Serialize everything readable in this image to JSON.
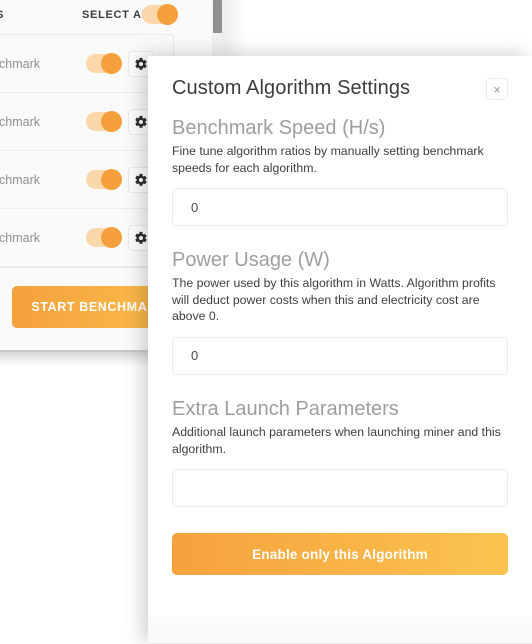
{
  "background_panel": {
    "list_header": {
      "truncated_label": "S",
      "select_all_label": "SELECT ALL",
      "select_all_toggle": {
        "name": "select-all-toggle",
        "state": "on"
      }
    },
    "algorithm_rows": [
      {
        "name_truncated": "chmark",
        "toggle_state": "on",
        "settings_icon": "gear-icon"
      },
      {
        "name_truncated": "chmark",
        "toggle_state": "on",
        "settings_icon": "gear-icon"
      },
      {
        "name_truncated": "chmark",
        "toggle_state": "on",
        "settings_icon": "gear-icon"
      },
      {
        "name_truncated": "chmark",
        "toggle_state": "on",
        "settings_icon": "gear-icon"
      }
    ],
    "start_benchmark_label": "START BENCHMARK",
    "scrollbar": {
      "name": "vertical-scrollbar",
      "thumb_position": "top"
    }
  },
  "modal": {
    "title": "Custom Algorithm Settings",
    "close_icon": "close-icon",
    "close_glyph": "×",
    "fields": [
      {
        "title": "Benchmark Speed (H/s)",
        "description": "Fine tune algorithm ratios by manually setting benchmark speeds for each algorithm.",
        "value": "0",
        "placeholder": ""
      },
      {
        "title": "Power Usage (W)",
        "description": "The power used by this algorithm in Watts. Algorithm profits will deduct power costs when this and electricity cost are above 0.",
        "value": "0",
        "placeholder": ""
      },
      {
        "title": "Extra Launch Parameters",
        "description": "Additional launch parameters when launching miner and this algorithm.",
        "value": "",
        "placeholder": ""
      }
    ],
    "primary_button_label": "Enable only this Algorithm"
  },
  "colors": {
    "accent_orange": "#f5a03c",
    "accent_orange_light": "#fbc44f",
    "toggle_track": "#fcd7aa",
    "title_gray": "#3c3c3c",
    "label_gray": "#9e9e9e",
    "body_text": "#3e3e3e",
    "border": "#ebebeb"
  }
}
